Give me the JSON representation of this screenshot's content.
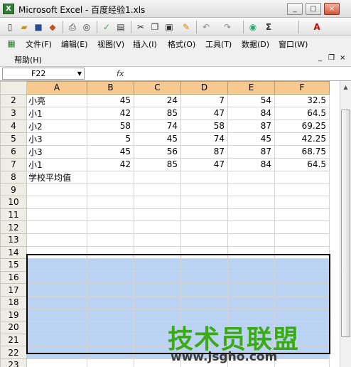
{
  "window": {
    "title": "Microsoft Excel - 百度经验1.xls",
    "app_icon": "X"
  },
  "window_controls": {
    "minimize": "_",
    "maximize": "□",
    "close": "×"
  },
  "toolbar": {
    "icons": [
      "new-file-icon",
      "open-folder-icon",
      "save-icon",
      "permission-icon",
      "print-icon",
      "print-preview-icon",
      "spelling-icon",
      "research-icon",
      "cut-icon",
      "copy-icon",
      "paste-icon",
      "format-painter-icon",
      "undo-icon",
      "redo-icon",
      "hyperlink-icon",
      "autosum-icon",
      "font-color-icon"
    ],
    "autosum_label": "Σ",
    "font_color_label": "A"
  },
  "menu": {
    "items": [
      "文件(F)",
      "编辑(E)",
      "视图(V)",
      "插入(I)",
      "格式(O)",
      "工具(T)",
      "数据(D)",
      "窗口(W)"
    ],
    "help": "帮助(H)"
  },
  "formula_bar": {
    "name_box": "F22",
    "fx": "fx",
    "value": ""
  },
  "sheet": {
    "columns": [
      "A",
      "B",
      "C",
      "D",
      "E",
      "F"
    ],
    "rows": [
      {
        "num": "2",
        "cells": [
          "小亮",
          "45",
          "24",
          "7",
          "54",
          "32.5"
        ]
      },
      {
        "num": "3",
        "cells": [
          "小1",
          "42",
          "85",
          "47",
          "84",
          "64.5"
        ]
      },
      {
        "num": "4",
        "cells": [
          "小2",
          "58",
          "74",
          "58",
          "87",
          "69.25"
        ]
      },
      {
        "num": "5",
        "cells": [
          "小3",
          "5",
          "45",
          "74",
          "45",
          "42.25"
        ]
      },
      {
        "num": "6",
        "cells": [
          "小3",
          "45",
          "56",
          "87",
          "87",
          "68.75"
        ]
      },
      {
        "num": "7",
        "cells": [
          "小1",
          "42",
          "85",
          "47",
          "84",
          "64.5"
        ]
      },
      {
        "num": "8",
        "cells": [
          "学校平均值",
          "",
          "",
          "",
          "",
          ""
        ]
      },
      {
        "num": "9",
        "cells": [
          "",
          "",
          "",
          "",
          "",
          ""
        ]
      },
      {
        "num": "10",
        "cells": [
          "",
          "",
          "",
          "",
          "",
          ""
        ]
      },
      {
        "num": "11",
        "cells": [
          "",
          "",
          "",
          "",
          "",
          ""
        ]
      },
      {
        "num": "12",
        "cells": [
          "",
          "",
          "",
          "",
          "",
          ""
        ]
      },
      {
        "num": "13",
        "cells": [
          "",
          "",
          "",
          "",
          "",
          ""
        ]
      },
      {
        "num": "14",
        "cells": [
          "",
          "",
          "",
          "",
          "",
          ""
        ]
      },
      {
        "num": "15",
        "cells": [
          "",
          "",
          "",
          "",
          "",
          ""
        ]
      },
      {
        "num": "16",
        "cells": [
          "",
          "",
          "",
          "",
          "",
          ""
        ]
      },
      {
        "num": "17",
        "cells": [
          "",
          "",
          "",
          "",
          "",
          ""
        ]
      },
      {
        "num": "18",
        "cells": [
          "",
          "",
          "",
          "",
          "",
          ""
        ]
      },
      {
        "num": "19",
        "cells": [
          "",
          "",
          "",
          "",
          "",
          ""
        ]
      },
      {
        "num": "20",
        "cells": [
          "",
          "",
          "",
          "",
          "",
          ""
        ]
      },
      {
        "num": "21",
        "cells": [
          "",
          "",
          "",
          "",
          "",
          ""
        ]
      },
      {
        "num": "22",
        "cells": [
          "",
          "",
          "",
          "",
          "",
          ""
        ]
      },
      {
        "num": "23",
        "cells": [
          "",
          "",
          "",
          "",
          "",
          ""
        ]
      }
    ],
    "selected_range": "A15:F22"
  },
  "watermark": {
    "main": "技术员联盟",
    "url": "www.jsgho.com"
  }
}
